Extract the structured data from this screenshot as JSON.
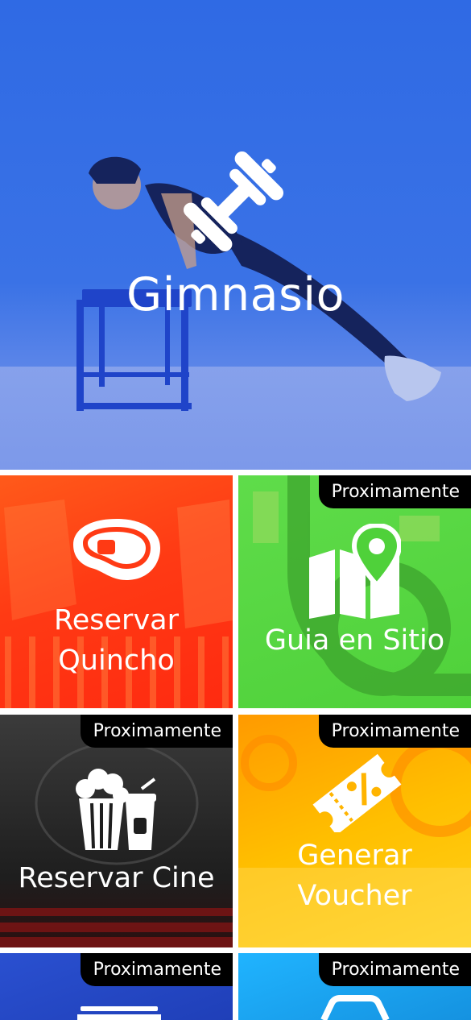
{
  "hero": {
    "title": "Gimnasio",
    "icon": "dumbbell-icon"
  },
  "tiles": [
    {
      "label_line1": "Reservar",
      "label_line2": "Quincho",
      "badge": "",
      "icon": "steak-icon",
      "color": "#ff3b1a"
    },
    {
      "label_line1": "Guia en Sitio",
      "badge": "Proximamente",
      "icon": "map-pin-icon",
      "color": "#4fd13a"
    },
    {
      "label_line1": "Reservar Cine",
      "badge": "Proximamente",
      "icon": "popcorn-soda-icon",
      "color": "#2a2a2a"
    },
    {
      "label_line1": "Generar",
      "label_line2": "Voucher",
      "badge": "Proximamente",
      "icon": "voucher-percent-icon",
      "color": "#ffb400"
    },
    {
      "label_line1": "",
      "badge": "Proximamente",
      "icon": "truck-icon",
      "color": "#2848c8"
    },
    {
      "label_line1": "",
      "badge": "Proximamente",
      "icon": "car-icon",
      "color": "#1aa4f0"
    }
  ]
}
